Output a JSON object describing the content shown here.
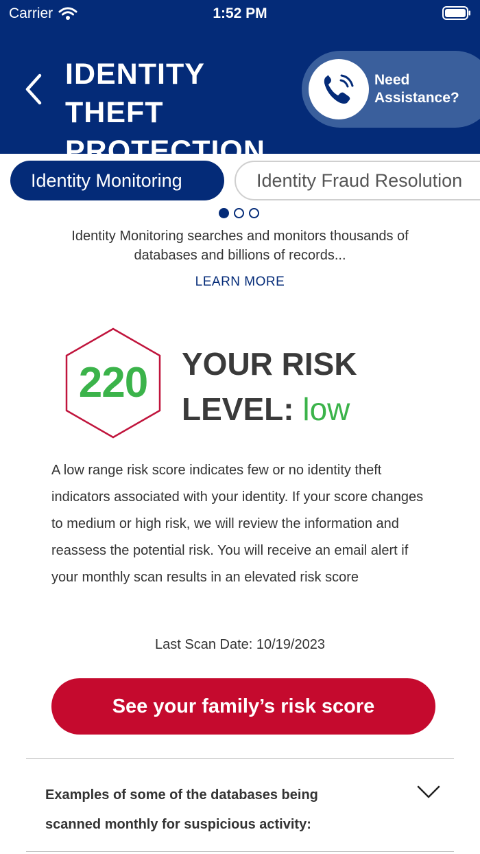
{
  "status_bar": {
    "carrier": "Carrier",
    "time": "1:52 PM"
  },
  "header": {
    "title": "IDENTITY THEFT PROTECTION",
    "assist_label": "Need Assistance?"
  },
  "tabs": [
    {
      "label": "Identity Monitoring",
      "active": true
    },
    {
      "label": "Identity Fraud Resolution",
      "active": false
    }
  ],
  "pager": {
    "count": 3,
    "current": 1
  },
  "intro": {
    "text": "Identity Monitoring searches and monitors thousands of databases and billions of records...",
    "link": "LEARN MORE"
  },
  "risk": {
    "score": "220",
    "heading_line1": "YOUR RISK",
    "heading_line2": "LEVEL:",
    "level": "low",
    "description": "A low range risk score indicates few or no identity theft indicators associated with your identity. If your score changes to medium or high risk, we will review the information and reassess the potential risk. You will receive an email alert if your monthly scan results in an elevated risk score",
    "last_scan": "Last Scan Date: 10/19/2023"
  },
  "cta": {
    "label": "See your family’s risk score"
  },
  "accordion": {
    "label": "Examples of some of the databases being scanned monthly for suspicious activity:"
  },
  "colors": {
    "brand_navy": "#042b78",
    "assist_blue": "#3a5f9c",
    "score_green": "#3bb34a",
    "hex_red": "#c0143c",
    "cta_red": "#c50a2e"
  },
  "icons": [
    "wifi-icon",
    "battery-icon",
    "back-chevron-icon",
    "phone-icon",
    "chevron-down-icon"
  ]
}
